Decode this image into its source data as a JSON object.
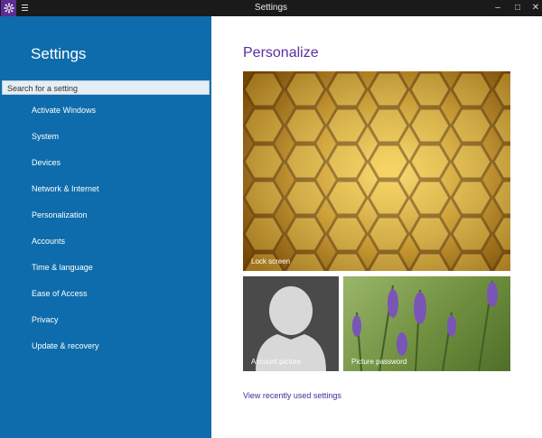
{
  "window": {
    "title": "Settings"
  },
  "sidebar": {
    "title": "Settings",
    "search_placeholder": "Search for a setting",
    "items": [
      {
        "label": "Activate Windows"
      },
      {
        "label": "System"
      },
      {
        "label": "Devices"
      },
      {
        "label": "Network & Internet"
      },
      {
        "label": "Personalization"
      },
      {
        "label": "Accounts"
      },
      {
        "label": "Time & language"
      },
      {
        "label": "Ease of Access"
      },
      {
        "label": "Privacy"
      },
      {
        "label": "Update & recovery"
      }
    ]
  },
  "main": {
    "title": "Personalize",
    "tiles": {
      "lock_screen": "Lock screen",
      "account_picture": "Account picture",
      "picture_password": "Picture password"
    },
    "recent_link": "View recently used settings"
  },
  "colors": {
    "sidebar": "#0e6cac",
    "accent_purple": "#5b2d9e",
    "titlebar": "#1a1a1a"
  },
  "icons": [
    "gear-icon",
    "hamburger-menu-icon",
    "minimize-icon",
    "maximize-icon",
    "close-icon",
    "user-silhouette-icon"
  ]
}
